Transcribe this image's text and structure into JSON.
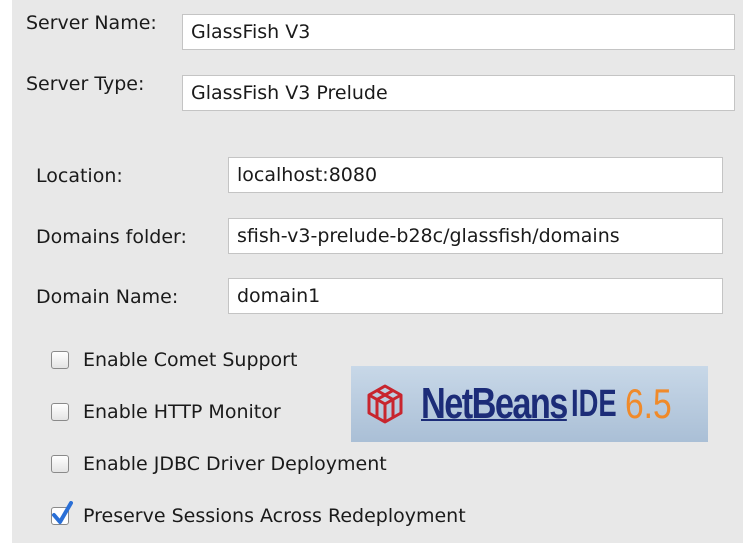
{
  "form": {
    "server_name": {
      "label": "Server Name:",
      "value": "GlassFish V3"
    },
    "server_type": {
      "label": "Server Type:",
      "value": "GlassFish V3 Prelude"
    },
    "location": {
      "label": "Location:",
      "value": "localhost:8080"
    },
    "domains_folder": {
      "label": "Domains folder:",
      "value": "sfish-v3-prelude-b28c/glassfish/domains"
    },
    "domain_name": {
      "label": "Domain Name:",
      "value": "domain1"
    }
  },
  "options": [
    {
      "label": "Enable Comet Support",
      "checked": false
    },
    {
      "label": "Enable HTTP Monitor",
      "checked": false
    },
    {
      "label": "Enable JDBC Driver Deployment",
      "checked": false
    },
    {
      "label": "Preserve Sessions Across Redeployment",
      "checked": true
    }
  ],
  "banner": {
    "brand": "NetBeans",
    "ide": "IDE",
    "version": "6.5",
    "icon": "netbeans-cube-icon"
  },
  "colors": {
    "panel_bg": "#e8e8e8",
    "checkbox_tick": "#2a6fd6",
    "brand_blue": "#1c2c78",
    "version_orange": "#f08a2a",
    "logo_red": "#c8252e"
  }
}
